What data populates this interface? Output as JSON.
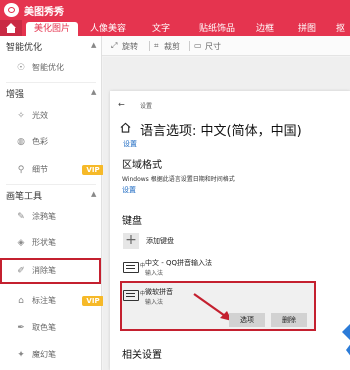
{
  "app": {
    "title": "美图秀秀"
  },
  "tabs": [
    {
      "label": "美化图片",
      "active": true
    },
    {
      "label": "人像美容"
    },
    {
      "label": "文字"
    },
    {
      "label": "贴纸饰品"
    },
    {
      "label": "边框"
    },
    {
      "label": "拼图"
    },
    {
      "label": "抠"
    }
  ],
  "toolbar": {
    "rotate": "旋转",
    "crop": "裁剪",
    "resize": "尺寸"
  },
  "sidebar": {
    "smart_header": "智能优化",
    "smart_item": "智能优化",
    "enhance_header": "增强",
    "light": "光效",
    "color": "色彩",
    "detail": "细节",
    "brush_header": "画笔工具",
    "doodle": "涂鸦笔",
    "shape": "形状笔",
    "erase": "消除笔",
    "mark": "标注笔",
    "picker": "取色笔",
    "magic": "魔幻笔",
    "vip": "VIP"
  },
  "settings": {
    "back_arrow": "←",
    "breadcrumb": "设置",
    "title": "语言选项: 中文(简体，中国)",
    "settings_link": "设置",
    "region_heading": "区域格式",
    "region_desc": "Windows 根据此语言设置日期和时间格式",
    "region_link": "设置",
    "keyboard_heading": "键盘",
    "add_keyboard": "添加键盘",
    "ime1_name": "中文 - QQ拼音输入法",
    "ime1_sub": "输入法",
    "ime2_name": "微软拼音",
    "ime2_sub": "输入法",
    "kb_tag": "中",
    "options_button": "选项",
    "delete_button": "删除",
    "related_heading": "相关设置"
  },
  "colors": {
    "brand": "#e5344f",
    "highlight": "#c4202f",
    "link": "#1565c0",
    "vip": "#f6b928"
  }
}
